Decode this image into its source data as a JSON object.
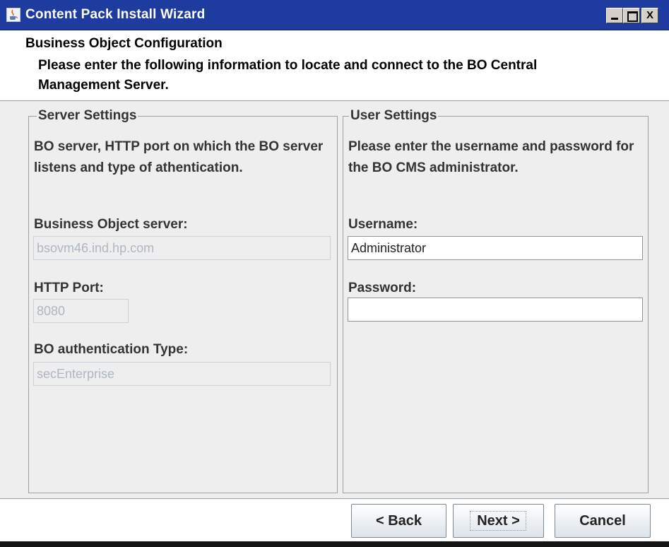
{
  "window": {
    "title": "Content Pack Install Wizard",
    "icon": "java-cup-icon",
    "controls": [
      "minimize-icon",
      "maximize-icon",
      "close-icon"
    ],
    "close_glyph": "X"
  },
  "header": {
    "title": "Business Object Configuration",
    "description": "Please enter the following information to locate and connect to the BO Central Management Server."
  },
  "server_settings": {
    "legend": "Server Settings",
    "description": "BO server, HTTP port on which the BO server listens and type of athentication.",
    "server_label": "Business Object server:",
    "server_value": "bsovm46.ind.hp.com",
    "port_label": "HTTP Port:",
    "port_value": "8080",
    "auth_label": "BO authentication Type:",
    "auth_value": "secEnterprise"
  },
  "user_settings": {
    "legend": "User Settings",
    "description": "Please enter the username and password for the BO CMS administrator.",
    "username_label": "Username:",
    "username_value": "Administrator",
    "password_label": "Password:",
    "password_value": ""
  },
  "buttons": {
    "back": "< Back",
    "next": "Next >",
    "cancel": "Cancel"
  },
  "colors": {
    "titlebar": "#1e3c9f",
    "panel_background": "#eeeeee",
    "disabled_text": "#aeb7c1"
  }
}
